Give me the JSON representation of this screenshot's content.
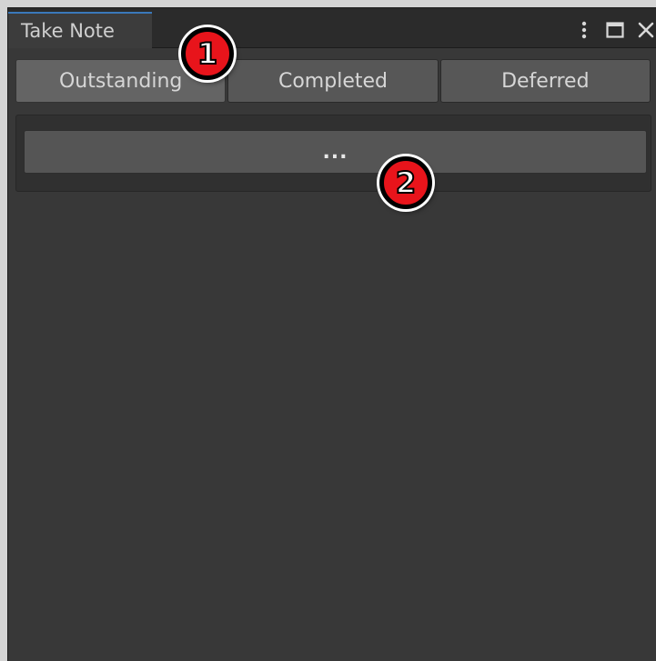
{
  "window": {
    "tab_title": "Take Note",
    "icons": [
      "more-vertical-icon",
      "maximize-icon",
      "close-icon"
    ]
  },
  "filter_tabs": [
    {
      "label": "Outstanding",
      "selected": true
    },
    {
      "label": "Completed",
      "selected": false
    },
    {
      "label": "Deferred",
      "selected": false
    }
  ],
  "list": {
    "more_label": "..."
  },
  "annotations": [
    {
      "label": "1"
    },
    {
      "label": "2"
    }
  ],
  "colors": {
    "accent_tab_line": "#3a79bb",
    "marker_fill": "#e8141b"
  }
}
